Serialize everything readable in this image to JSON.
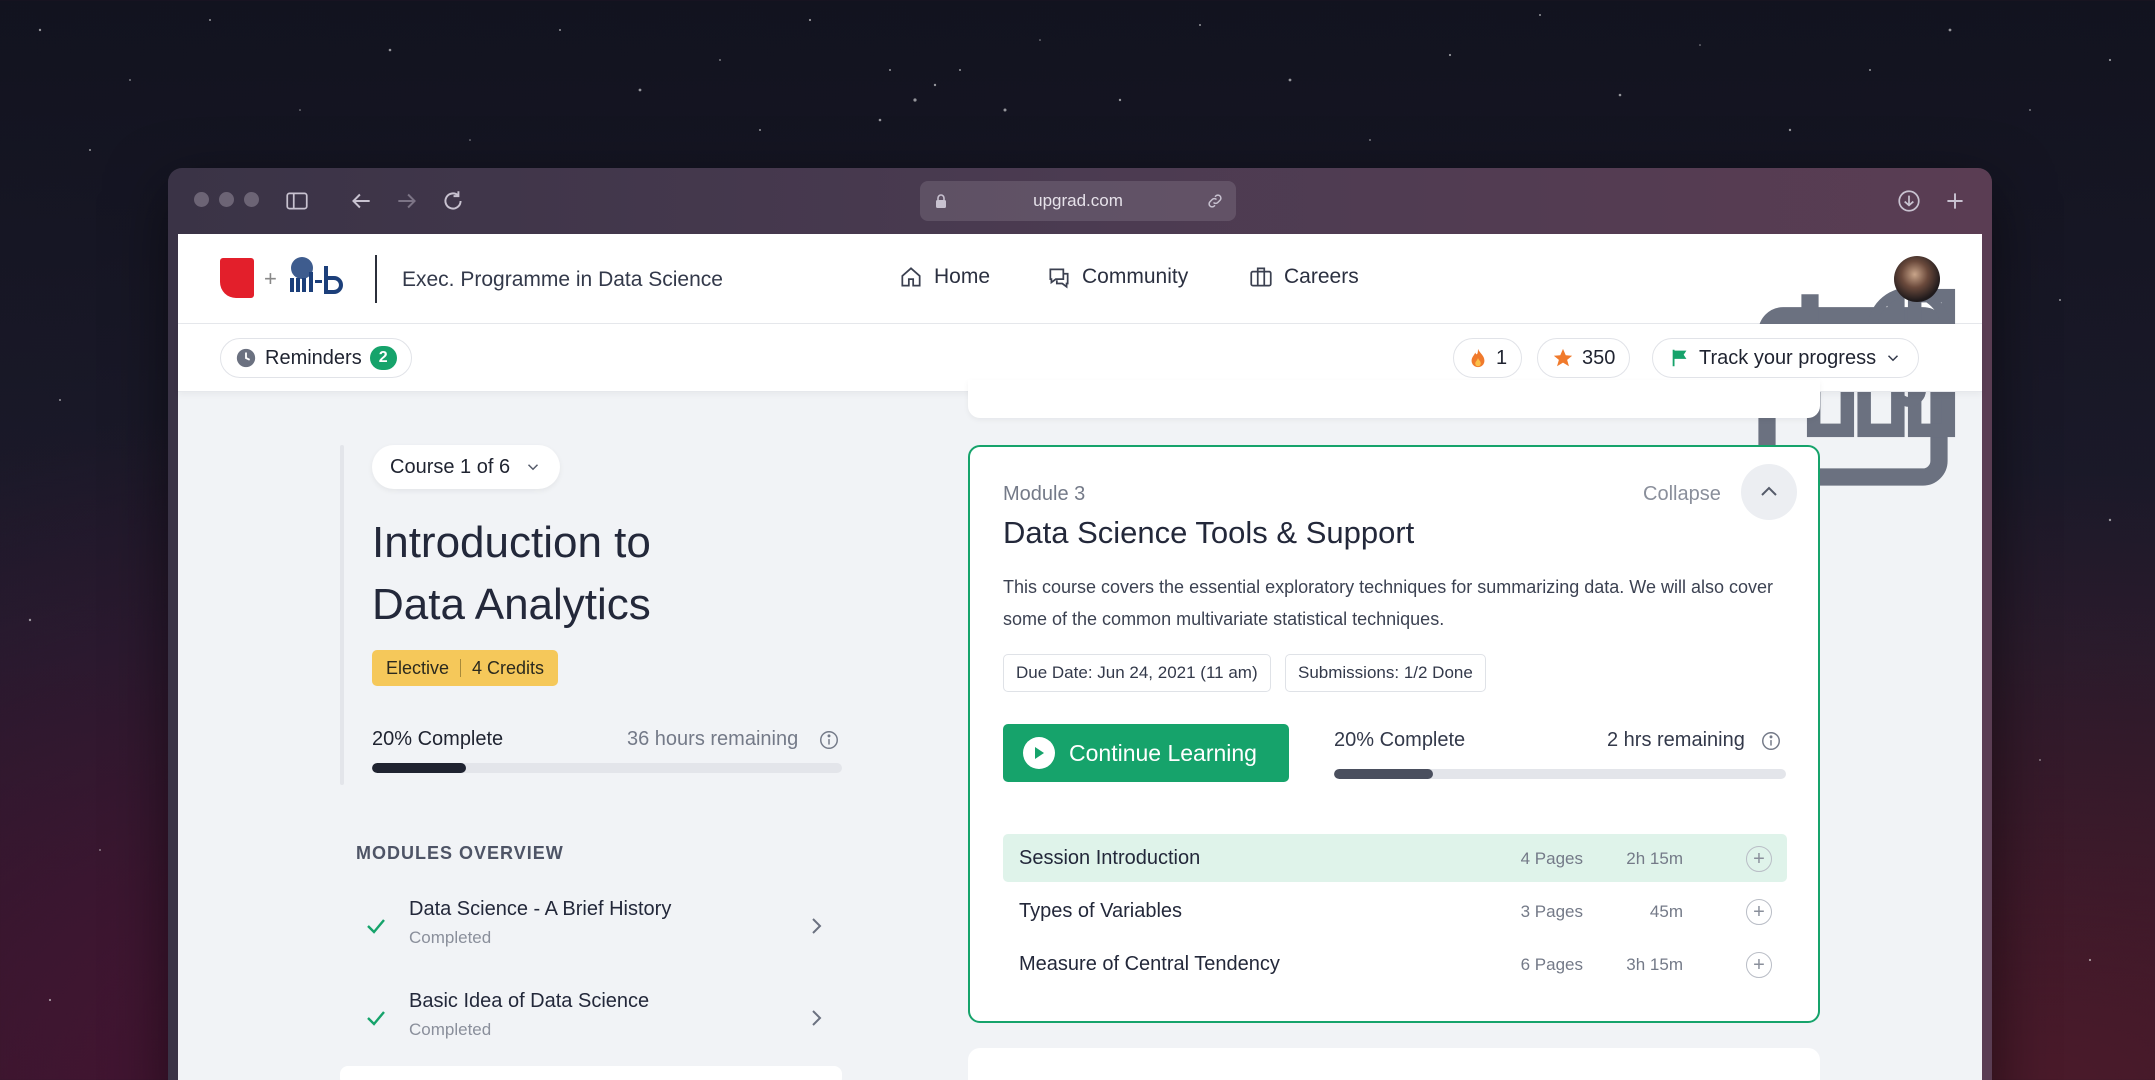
{
  "browser": {
    "url": "upgrad.com"
  },
  "topnav": {
    "program_title": "Exec. Programme in Data Science",
    "nav": [
      {
        "label": "Home",
        "icon": "home-icon"
      },
      {
        "label": "Community",
        "icon": "chat-icon"
      },
      {
        "label": "Careers",
        "icon": "briefcase-icon"
      }
    ],
    "right_icons": [
      "calendar-icon",
      "bar-chart-icon",
      "bell-icon"
    ]
  },
  "subbar": {
    "reminders_label": "Reminders",
    "reminders_count": "2",
    "streak_count": "1",
    "points": "350",
    "track_label": "Track your progress"
  },
  "course": {
    "selector": "Course 1 of 6",
    "title_line1": "Introduction to",
    "title_line2": "Data Analytics",
    "tag_type": "Elective",
    "tag_credits": "4 Credits",
    "complete_label": "20% Complete",
    "progress": 0.2,
    "remaining": "36 hours remaining"
  },
  "modules_overview": {
    "heading": "MODULES OVERVIEW",
    "items": [
      {
        "title": "Data Science - A Brief History",
        "status": "Completed"
      },
      {
        "title": "Basic Idea of Data Science",
        "status": "Completed"
      }
    ]
  },
  "module_card": {
    "label": "Module 3",
    "title": "Data Science Tools & Support",
    "collapse_label": "Collapse",
    "description": "This course covers the essential exploratory techniques for summarizing data. We will also cover some of the common multivariate statistical techniques.",
    "due_date": "Due Date: Jun 24, 2021 (11 am)",
    "submissions": "Submissions: 1/2 Done",
    "continue_label": "Continue Learning",
    "complete_label": "20% Complete",
    "progress": 0.22,
    "remaining": "2 hrs remaining",
    "sessions": [
      {
        "name": "Session Introduction",
        "pages": "4 Pages",
        "duration": "2h 15m",
        "active": true
      },
      {
        "name": "Types of Variables",
        "pages": "3 Pages",
        "duration": "45m",
        "active": false
      },
      {
        "name": "Measure of Central Tendency",
        "pages": "6 Pages",
        "duration": "3h 15m",
        "active": false
      }
    ]
  },
  "colors": {
    "accent_green": "#16a36b",
    "tag_yellow": "#f5c85a",
    "logo_red": "#e31f2b"
  }
}
